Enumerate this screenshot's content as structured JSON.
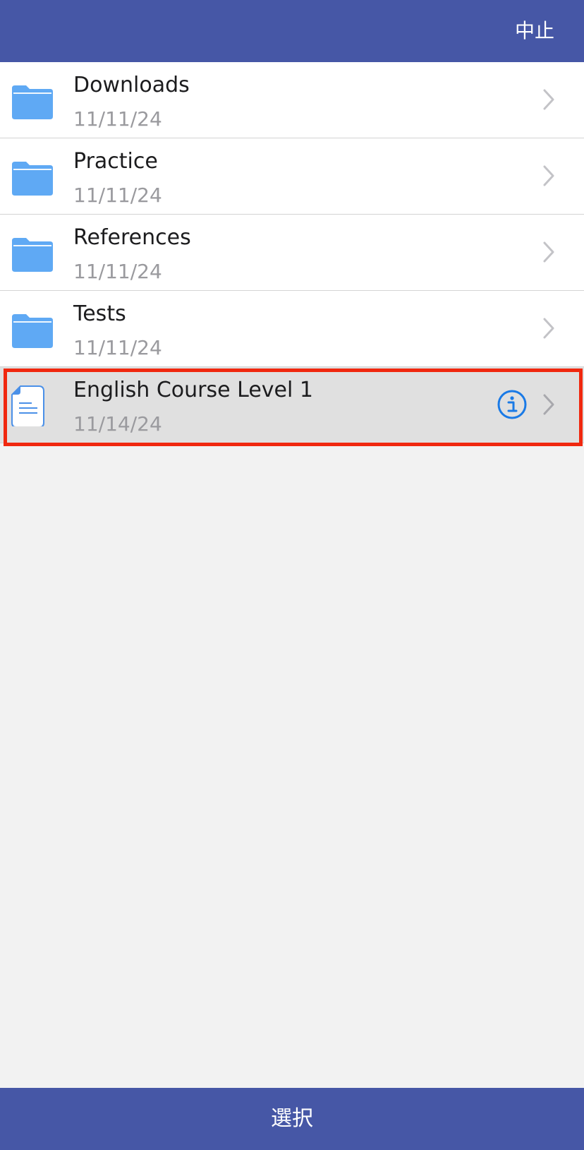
{
  "header": {
    "cancel_label": "中止"
  },
  "items": [
    {
      "name": "Downloads",
      "date": "11/11/24",
      "icon": "folder-icon"
    },
    {
      "name": "Practice",
      "date": "11/11/24",
      "icon": "folder-icon"
    },
    {
      "name": "References",
      "date": "11/11/24",
      "icon": "folder-icon"
    },
    {
      "name": "Tests",
      "date": "11/11/24",
      "icon": "folder-icon"
    },
    {
      "name": "English Course Level 1",
      "date": "11/14/24",
      "icon": "document-icon",
      "selected": true
    }
  ],
  "footer": {
    "select_label": "選択"
  },
  "colors": {
    "bar": "#4657a6",
    "folder": "#5fa9f4",
    "accent": "#1a7ae6",
    "highlight": "#f0280f"
  }
}
